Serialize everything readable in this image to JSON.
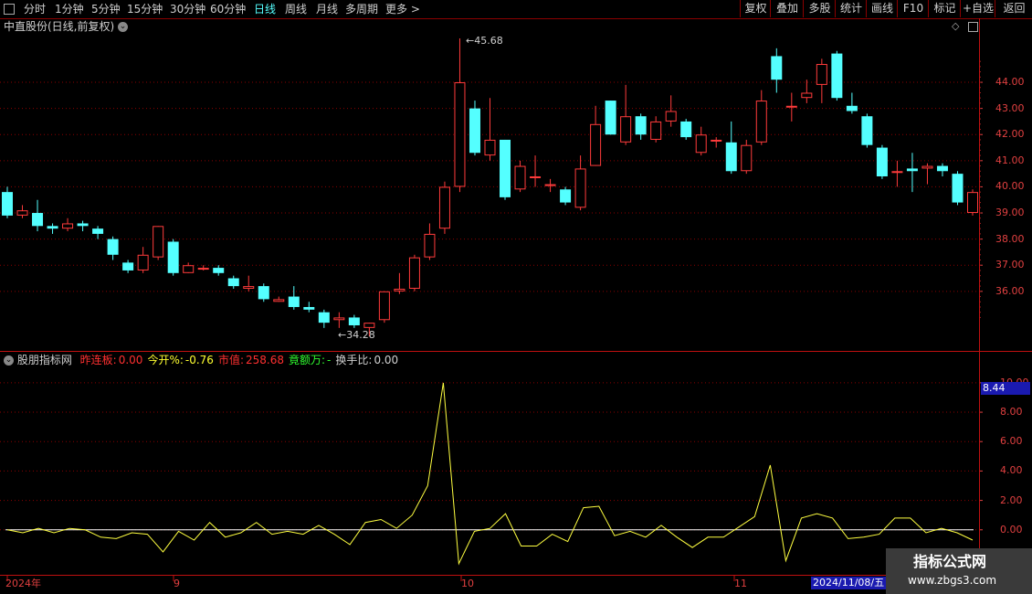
{
  "toolbar": {
    "left_items": [
      {
        "label": "分时",
        "active": false
      },
      {
        "label": "1分钟",
        "active": false
      },
      {
        "label": "5分钟",
        "active": false
      },
      {
        "label": "15分钟",
        "active": false
      },
      {
        "label": "30分钟",
        "active": false
      },
      {
        "label": "60分钟",
        "active": false
      },
      {
        "label": "日线",
        "active": true
      },
      {
        "label": "周线",
        "active": false
      },
      {
        "label": "月线",
        "active": false
      },
      {
        "label": "多周期",
        "active": false
      },
      {
        "label": "更多 >",
        "active": false
      }
    ],
    "right_items": [
      "复权",
      "叠加",
      "多股",
      "统计",
      "画线",
      "F10",
      "标记",
      "+自选",
      "返回"
    ]
  },
  "main_chart": {
    "title": "中直股份(日线,前复权)",
    "high_label": "45.68",
    "low_label": "34.28",
    "y_ticks": [
      "44.00",
      "43.00",
      "42.00",
      "41.00",
      "40.00",
      "39.00",
      "38.00",
      "37.00",
      "36.00"
    ]
  },
  "indicator": {
    "name": "股朋指标网",
    "fields": [
      {
        "label": "昨连板:",
        "value": "0.00",
        "color": "#ff3030"
      },
      {
        "label": "今开%:",
        "value": "-0.76",
        "color": "#ffff30"
      },
      {
        "label": "市值:",
        "value": "258.68",
        "color": "#ff3030"
      },
      {
        "label": "竟额万:",
        "value": "-",
        "color": "#30ff30"
      },
      {
        "label": "换手比:",
        "value": "0.00",
        "color": "#d0d0d0"
      }
    ],
    "y_ticks": [
      "10.00",
      "8.00",
      "6.00",
      "4.00",
      "2.00",
      "0.00"
    ],
    "current_value": "8.44"
  },
  "x_axis": {
    "labels": [
      "2024年",
      "9",
      "10",
      "11"
    ],
    "cursor_date": "2024/11/08/五"
  },
  "watermark": {
    "title": "指标公式网",
    "url": "www.zbgs3.com"
  },
  "colors": {
    "up": "#ff3b3b",
    "down": "#54ffff",
    "indicator": "#ffff40",
    "grid": "#8b0000",
    "zero_line": "#ffffff"
  },
  "chart_data": [
    {
      "type": "candlestick",
      "title": "中直股份(日线,前复权)",
      "ylim": [
        34.28,
        45.68
      ],
      "candles": [
        {
          "o": 39.8,
          "h": 40.0,
          "l": 38.8,
          "c": 38.9
        },
        {
          "o": 38.9,
          "h": 39.3,
          "l": 38.8,
          "c": 39.1
        },
        {
          "o": 39.0,
          "h": 39.5,
          "l": 38.3,
          "c": 38.5
        },
        {
          "o": 38.5,
          "h": 38.6,
          "l": 38.2,
          "c": 38.4
        },
        {
          "o": 38.4,
          "h": 38.8,
          "l": 38.3,
          "c": 38.6
        },
        {
          "o": 38.6,
          "h": 38.7,
          "l": 38.3,
          "c": 38.5
        },
        {
          "o": 38.4,
          "h": 38.5,
          "l": 38.0,
          "c": 38.2
        },
        {
          "o": 38.0,
          "h": 38.1,
          "l": 37.2,
          "c": 37.4
        },
        {
          "o": 37.1,
          "h": 37.2,
          "l": 36.7,
          "c": 36.8
        },
        {
          "o": 36.8,
          "h": 37.7,
          "l": 36.7,
          "c": 37.4
        },
        {
          "o": 37.3,
          "h": 38.5,
          "l": 37.2,
          "c": 38.5
        },
        {
          "o": 37.9,
          "h": 38.0,
          "l": 36.6,
          "c": 36.7
        },
        {
          "o": 36.7,
          "h": 37.1,
          "l": 36.7,
          "c": 37.0
        },
        {
          "o": 36.9,
          "h": 37.0,
          "l": 36.8,
          "c": 36.9
        },
        {
          "o": 36.9,
          "h": 37.0,
          "l": 36.6,
          "c": 36.7
        },
        {
          "o": 36.5,
          "h": 36.6,
          "l": 36.1,
          "c": 36.2
        },
        {
          "o": 36.1,
          "h": 36.6,
          "l": 36.0,
          "c": 36.2
        },
        {
          "o": 36.2,
          "h": 36.3,
          "l": 35.6,
          "c": 35.7
        },
        {
          "o": 35.6,
          "h": 35.8,
          "l": 35.6,
          "c": 35.7
        },
        {
          "o": 35.8,
          "h": 36.2,
          "l": 35.3,
          "c": 35.4
        },
        {
          "o": 35.4,
          "h": 35.6,
          "l": 35.2,
          "c": 35.3
        },
        {
          "o": 35.2,
          "h": 35.3,
          "l": 34.6,
          "c": 34.8
        },
        {
          "o": 34.9,
          "h": 35.2,
          "l": 34.6,
          "c": 35.0
        },
        {
          "o": 35.0,
          "h": 35.1,
          "l": 34.6,
          "c": 34.7
        },
        {
          "o": 34.6,
          "h": 34.8,
          "l": 34.28,
          "c": 34.8
        },
        {
          "o": 34.9,
          "h": 36.0,
          "l": 34.8,
          "c": 36.0
        },
        {
          "o": 36.0,
          "h": 36.7,
          "l": 35.9,
          "c": 36.1
        },
        {
          "o": 36.1,
          "h": 37.4,
          "l": 36.0,
          "c": 37.3
        },
        {
          "o": 37.3,
          "h": 38.6,
          "l": 37.2,
          "c": 38.2
        },
        {
          "o": 38.4,
          "h": 40.2,
          "l": 38.2,
          "c": 40.0
        },
        {
          "o": 40.0,
          "h": 45.68,
          "l": 39.8,
          "c": 44.0
        },
        {
          "o": 43.0,
          "h": 43.3,
          "l": 41.2,
          "c": 41.3
        },
        {
          "o": 41.2,
          "h": 43.4,
          "l": 41.0,
          "c": 41.8
        },
        {
          "o": 41.8,
          "h": 41.8,
          "l": 39.5,
          "c": 39.6
        },
        {
          "o": 39.9,
          "h": 41.0,
          "l": 39.8,
          "c": 40.8
        },
        {
          "o": 40.4,
          "h": 41.2,
          "l": 40.0,
          "c": 40.4
        },
        {
          "o": 40.1,
          "h": 40.3,
          "l": 39.8,
          "c": 40.1
        },
        {
          "o": 39.9,
          "h": 40.0,
          "l": 39.3,
          "c": 39.4
        },
        {
          "o": 39.2,
          "h": 41.2,
          "l": 39.1,
          "c": 40.7
        },
        {
          "o": 40.8,
          "h": 43.1,
          "l": 40.8,
          "c": 42.4
        },
        {
          "o": 43.3,
          "h": 43.3,
          "l": 42.0,
          "c": 42.0
        },
        {
          "o": 41.7,
          "h": 43.9,
          "l": 41.6,
          "c": 42.7
        },
        {
          "o": 42.7,
          "h": 42.8,
          "l": 41.8,
          "c": 42.0
        },
        {
          "o": 41.8,
          "h": 42.7,
          "l": 41.7,
          "c": 42.5
        },
        {
          "o": 42.5,
          "h": 43.5,
          "l": 42.3,
          "c": 42.9
        },
        {
          "o": 42.5,
          "h": 42.6,
          "l": 41.8,
          "c": 41.9
        },
        {
          "o": 41.3,
          "h": 42.3,
          "l": 41.2,
          "c": 42.0
        },
        {
          "o": 41.8,
          "h": 41.9,
          "l": 41.5,
          "c": 41.8
        },
        {
          "o": 41.7,
          "h": 42.5,
          "l": 40.5,
          "c": 40.6
        },
        {
          "o": 40.6,
          "h": 41.8,
          "l": 40.5,
          "c": 41.6
        },
        {
          "o": 41.7,
          "h": 43.7,
          "l": 41.6,
          "c": 43.3
        },
        {
          "o": 45.0,
          "h": 45.3,
          "l": 43.6,
          "c": 44.1
        },
        {
          "o": 43.1,
          "h": 43.6,
          "l": 42.5,
          "c": 43.1
        },
        {
          "o": 43.4,
          "h": 44.1,
          "l": 43.2,
          "c": 43.6
        },
        {
          "o": 43.9,
          "h": 44.9,
          "l": 43.2,
          "c": 44.7
        },
        {
          "o": 45.1,
          "h": 45.2,
          "l": 43.3,
          "c": 43.4
        },
        {
          "o": 43.1,
          "h": 43.6,
          "l": 42.8,
          "c": 42.9
        },
        {
          "o": 42.7,
          "h": 42.8,
          "l": 41.5,
          "c": 41.6
        },
        {
          "o": 41.5,
          "h": 41.6,
          "l": 40.3,
          "c": 40.4
        },
        {
          "o": 40.6,
          "h": 41.0,
          "l": 40.0,
          "c": 40.6
        },
        {
          "o": 40.7,
          "h": 41.3,
          "l": 39.8,
          "c": 40.6
        },
        {
          "o": 40.7,
          "h": 40.9,
          "l": 40.1,
          "c": 40.8
        },
        {
          "o": 40.8,
          "h": 40.9,
          "l": 40.4,
          "c": 40.6
        },
        {
          "o": 40.5,
          "h": 40.6,
          "l": 39.3,
          "c": 39.4
        },
        {
          "o": 39.0,
          "h": 39.9,
          "l": 38.9,
          "c": 39.8
        }
      ]
    },
    {
      "type": "line",
      "ylim": [
        -2.5,
        10.8
      ],
      "series": [
        {
          "values": [
            0.0,
            -0.2,
            0.1,
            -0.2,
            0.1,
            0.0,
            -0.5,
            -0.6,
            -0.2,
            -0.3,
            -1.5,
            -0.1,
            -0.7,
            0.5,
            -0.5,
            -0.2,
            0.5,
            -0.3,
            -0.1,
            -0.3,
            0.3,
            -0.3,
            -1.0,
            0.5,
            0.7,
            0.1,
            1.0,
            3.0,
            10.0,
            -2.3,
            -0.1,
            0.1,
            1.1,
            -1.1,
            -1.1,
            -0.3,
            -0.8,
            1.5,
            1.6,
            -0.4,
            -0.1,
            -0.5,
            0.3,
            -0.5,
            -1.2,
            -0.5,
            -0.5,
            0.2,
            0.9,
            4.4,
            -2.1,
            0.8,
            1.1,
            0.8,
            -0.6,
            -0.5,
            -0.3,
            0.8,
            0.8,
            -0.2,
            0.1,
            -0.2,
            -0.7
          ]
        }
      ]
    }
  ]
}
